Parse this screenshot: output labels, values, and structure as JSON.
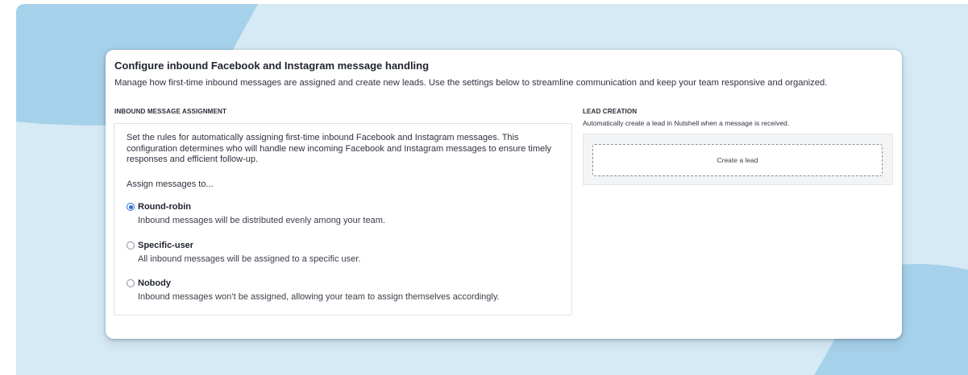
{
  "colors": {
    "backdrop": "#d6eaf5",
    "blob_dark": "#a6d1ea",
    "accent_radio": "#2d6cdf",
    "card": "#ffffff"
  },
  "header": {
    "title": "Configure inbound Facebook and Instagram message handling",
    "subtitle": "Manage how first-time inbound messages are assigned and create new leads. Use the settings below to streamline communication and keep your team responsive and organized."
  },
  "assignment": {
    "section_label": "INBOUND MESSAGE ASSIGNMENT",
    "description": "Set the rules for automatically assigning first-time inbound Facebook and Instagram messages. This configuration determines who will handle new incoming Facebook and Instagram messages to ensure timely responses and efficient follow-up.",
    "prompt": "Assign messages to...",
    "options": [
      {
        "label": "Round-robin",
        "description": "Inbound messages will be distributed evenly among your team.",
        "selected": true
      },
      {
        "label": "Specific-user",
        "description": "All inbound messages will be assigned to a specific user.",
        "selected": false
      },
      {
        "label": "Nobody",
        "description": "Inbound messages won’t be assigned, allowing your team to assign themselves accordingly.",
        "selected": false
      }
    ]
  },
  "lead_creation": {
    "section_label": "LEAD CREATION",
    "description": "Automatically create a lead in Nutshell when a message is received.",
    "button_label": "Create a lead"
  }
}
